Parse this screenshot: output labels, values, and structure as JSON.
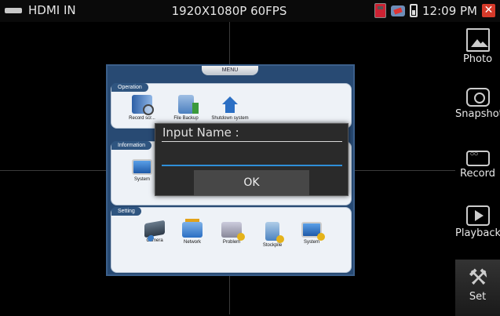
{
  "status_bar": {
    "source_label": "HDMI IN",
    "resolution": "1920X1080P 60FPS",
    "time": "12:09 PM",
    "icons": [
      "hdmi-icon",
      "record-status-icon",
      "network-icon",
      "battery-icon",
      "close-icon"
    ],
    "close_symbol": "✕"
  },
  "sidebar": {
    "items": [
      {
        "label": "Photo",
        "icon": "photo-icon"
      },
      {
        "label": "Snapshot",
        "icon": "camera-icon"
      },
      {
        "label": "Record",
        "icon": "video-record-icon"
      },
      {
        "label": "Playback",
        "icon": "play-icon"
      },
      {
        "label": "Set",
        "icon": "tools-icon"
      }
    ]
  },
  "menu": {
    "title": "MENU",
    "groups": [
      {
        "title": "Operation",
        "items": [
          {
            "label": "Record scr...",
            "icon": "film-search-icon"
          },
          {
            "label": "File Backup",
            "icon": "file-backup-icon"
          },
          {
            "label": "Shutdown system",
            "icon": "home-icon"
          }
        ]
      },
      {
        "title": "Information",
        "items": [
          {
            "label": "System",
            "icon": "monitor-icon"
          }
        ]
      },
      {
        "title": "Setting",
        "items": [
          {
            "label": "Camera",
            "icon": "camera-icon"
          },
          {
            "label": "Network",
            "icon": "network-icon"
          },
          {
            "label": "Problem",
            "icon": "problem-icon"
          },
          {
            "label": "Stockpile",
            "icon": "stockpile-icon"
          },
          {
            "label": "System",
            "icon": "system-settings-icon"
          }
        ]
      }
    ]
  },
  "dialog": {
    "title": "Input Name :",
    "input_value": "",
    "ok_label": "OK"
  },
  "colors": {
    "menu_bg": "#284a73",
    "group_bg": "#eef2f7",
    "dialog_bg": "#2a2a2a",
    "input_underline": "#2f8fd8",
    "close_red": "#d53a2a"
  }
}
